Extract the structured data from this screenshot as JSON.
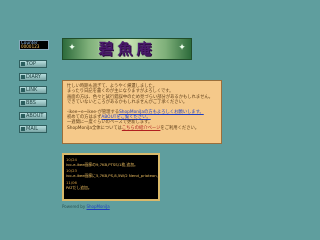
{
  "counter": {
    "label": "Counter",
    "value": "0000123"
  },
  "nav": {
    "items": [
      {
        "label": "TOP"
      },
      {
        "label": "DIARY"
      },
      {
        "label": "LINK"
      },
      {
        "label": "BBS"
      },
      {
        "label": "ABOUT"
      },
      {
        "label": "MAIL"
      }
    ]
  },
  "banner": {
    "title": "碧魚庵",
    "left_mark": "✦",
    "right_mark": "✦"
  },
  "notice": {
    "lines": [
      "忙しい時期も過ぎて、ようやく帰還しました。",
      "まったり日記を書くのが主になりますがよろしくです。",
      "画面の方は、色々と試行錯誤中のため見づらい部分があるかもしれません。",
      "できていないところがあるかもしれませんがご了承ください。",
      "",
      "-ikee~e~ikee-が管理する",
      "ShopMoniJaの方もよろしくお願いします。",
      "初めての方はまず",
      "ABOUTをご覧ください。",
      "一週間に一度ぐらいのペースで更新します。",
      "ShopMoniJa全体については",
      "こちらの紹介ページ",
      "をご利用ください。"
    ]
  },
  "log": {
    "entries": [
      {
        "date": "10/24",
        "text": "ivo-e-ikee画廊の9,7KB,PTSS/1枚,追加。"
      },
      {
        "date": "10/23",
        "text": "ivo-e-ikee画廊に5,7KB,PS,8,5W/2 Nend_prioteon,追加。"
      },
      {
        "date": "11/06",
        "text": "PATだし追加。"
      }
    ]
  },
  "powered": {
    "prefix": "Powered by",
    "link": "ShopMoniJa"
  }
}
